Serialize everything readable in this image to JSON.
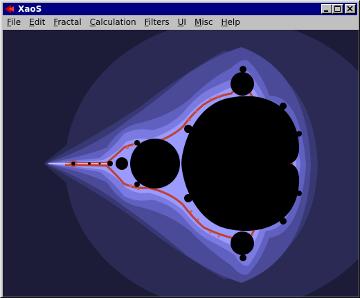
{
  "window": {
    "title": "XaoS"
  },
  "titlebar_buttons": {
    "minimize": "minimize",
    "maximize": "maximize",
    "close": "close"
  },
  "menu": [
    {
      "label": "File",
      "underline": "F",
      "rest": "ile"
    },
    {
      "label": "Edit",
      "underline": "E",
      "rest": "dit"
    },
    {
      "label": "Fractal",
      "underline": "F",
      "rest": "ractal"
    },
    {
      "label": "Calculation",
      "underline": "C",
      "rest": "alculation"
    },
    {
      "label": "Filters",
      "underline": "F",
      "rest": "ilters"
    },
    {
      "label": "UI",
      "underline": "U",
      "rest": "I"
    },
    {
      "label": "Misc",
      "underline": "M",
      "rest": "isc"
    },
    {
      "label": "Help",
      "underline": "H",
      "rest": "elp"
    }
  ],
  "colors": {
    "titlebar": "#000080",
    "outer_bg": "#1c1c38",
    "band1": "#2a2a55",
    "band2": "#383874",
    "band3": "#4a4a98",
    "band4": "#6060c0",
    "band5": "#7a7ae0",
    "band6": "#9a9aff",
    "edge": "#c04030",
    "set": "#000000"
  }
}
